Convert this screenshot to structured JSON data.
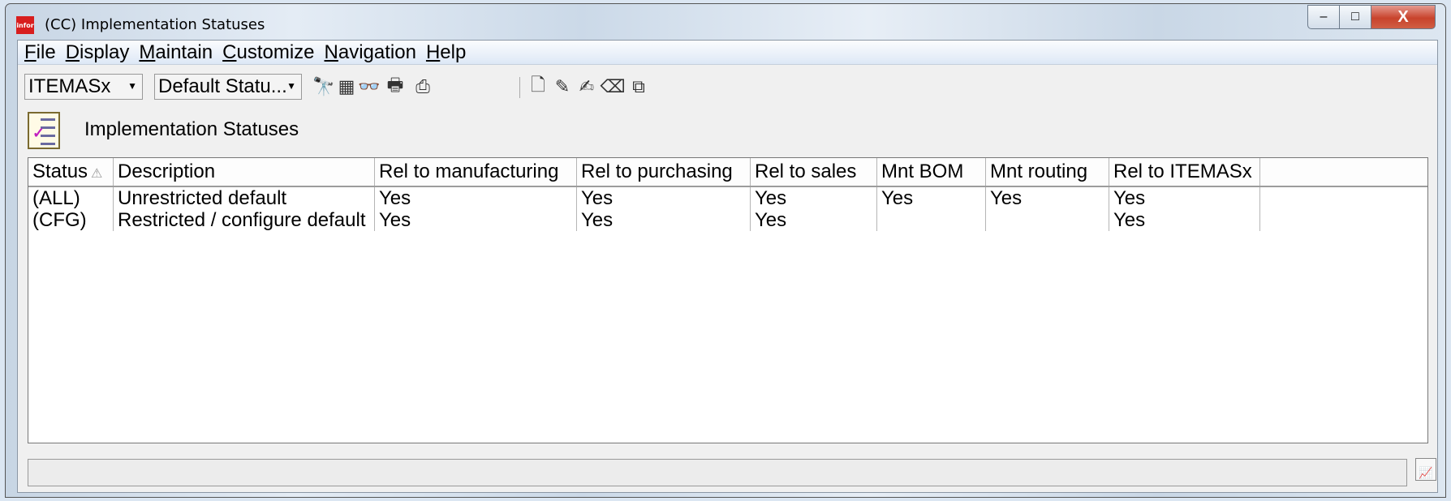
{
  "window": {
    "app_icon_text": "infor",
    "title": "(CC) Implementation Statuses",
    "minimize_glyph": "–",
    "maximize_glyph": "□",
    "close_glyph": "X"
  },
  "menu": [
    {
      "key": "F",
      "rest": "ile"
    },
    {
      "key": "D",
      "rest": "isplay"
    },
    {
      "key": "M",
      "rest": "aintain"
    },
    {
      "key": "C",
      "rest": "ustomize"
    },
    {
      "key": "N",
      "rest": "avigation"
    },
    {
      "key": "H",
      "rest": "elp"
    }
  ],
  "toolbar": {
    "combo1": {
      "value": "ITEMASx",
      "arrow": "▼"
    },
    "combo2": {
      "value": "Default Statu...",
      "arrow": "▼"
    },
    "icons": [
      {
        "name": "find-binoculars-icon",
        "glyph": "🔭"
      },
      {
        "name": "view-detail-icon",
        "glyph": "▦"
      },
      {
        "name": "glasses-icon",
        "glyph": "👓"
      },
      {
        "name": "print-preview-icon",
        "glyph": "🖶"
      },
      {
        "name": "printer-icon",
        "glyph": "⎙"
      },
      {
        "name": "new-document-icon",
        "glyph": "🗋"
      },
      {
        "name": "edit-pencil-icon",
        "glyph": "✎"
      },
      {
        "name": "edit-multiple-icon",
        "glyph": "✍"
      },
      {
        "name": "delete-icon",
        "glyph": "⌫"
      },
      {
        "name": "copy-icon",
        "glyph": "⧉"
      }
    ]
  },
  "header": {
    "title": "Implementation Statuses"
  },
  "table": {
    "sort_icon": "⚠",
    "columns": [
      "Status",
      "Description",
      "Rel to manufacturing",
      "Rel to purchasing",
      "Rel to sales",
      "Mnt BOM",
      "Mnt routing",
      "Rel to ITEMASx"
    ],
    "rows": [
      [
        "(ALL)",
        "Unrestricted default",
        "Yes",
        "Yes",
        "Yes",
        "Yes",
        "Yes",
        "Yes"
      ],
      [
        "(CFG)",
        "Restricted / configure default",
        "Yes",
        "Yes",
        "Yes",
        "",
        "",
        "Yes"
      ]
    ]
  },
  "status": {
    "text": "",
    "corner_icon": "📈"
  }
}
